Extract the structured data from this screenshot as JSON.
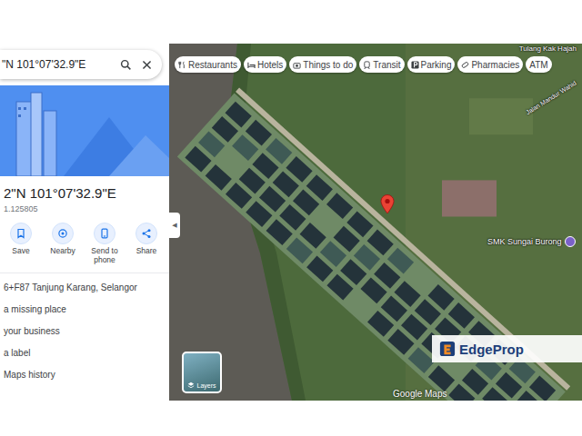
{
  "search": {
    "query": "\"N 101°07'32.9\"E"
  },
  "place": {
    "title": "2\"N 101°07'32.9\"E",
    "coordinates": "1.125805"
  },
  "actions": [
    {
      "label": "Save"
    },
    {
      "label": "Nearby"
    },
    {
      "label": "Send to phone"
    },
    {
      "label": "Share"
    }
  ],
  "details": [
    "6+F87 Tanjung Karang, Selangor",
    "a missing place",
    "your business",
    "a label",
    "Maps history"
  ],
  "map": {
    "chips": [
      "Restaurants",
      "Hotels",
      "Things to do",
      "Transit",
      "Parking",
      "Pharmacies",
      "ATM"
    ],
    "labels": [
      {
        "text": "Tulang Kak Hajah",
        "kind": "area"
      },
      {
        "text": "SMK Sungai Burong",
        "kind": "school"
      },
      {
        "text": "Jalan Mandur Wahid",
        "kind": "road"
      }
    ],
    "collapse": "◀",
    "layers": "Layers",
    "brand": "Google Maps",
    "watermark": "EdgeProp"
  }
}
